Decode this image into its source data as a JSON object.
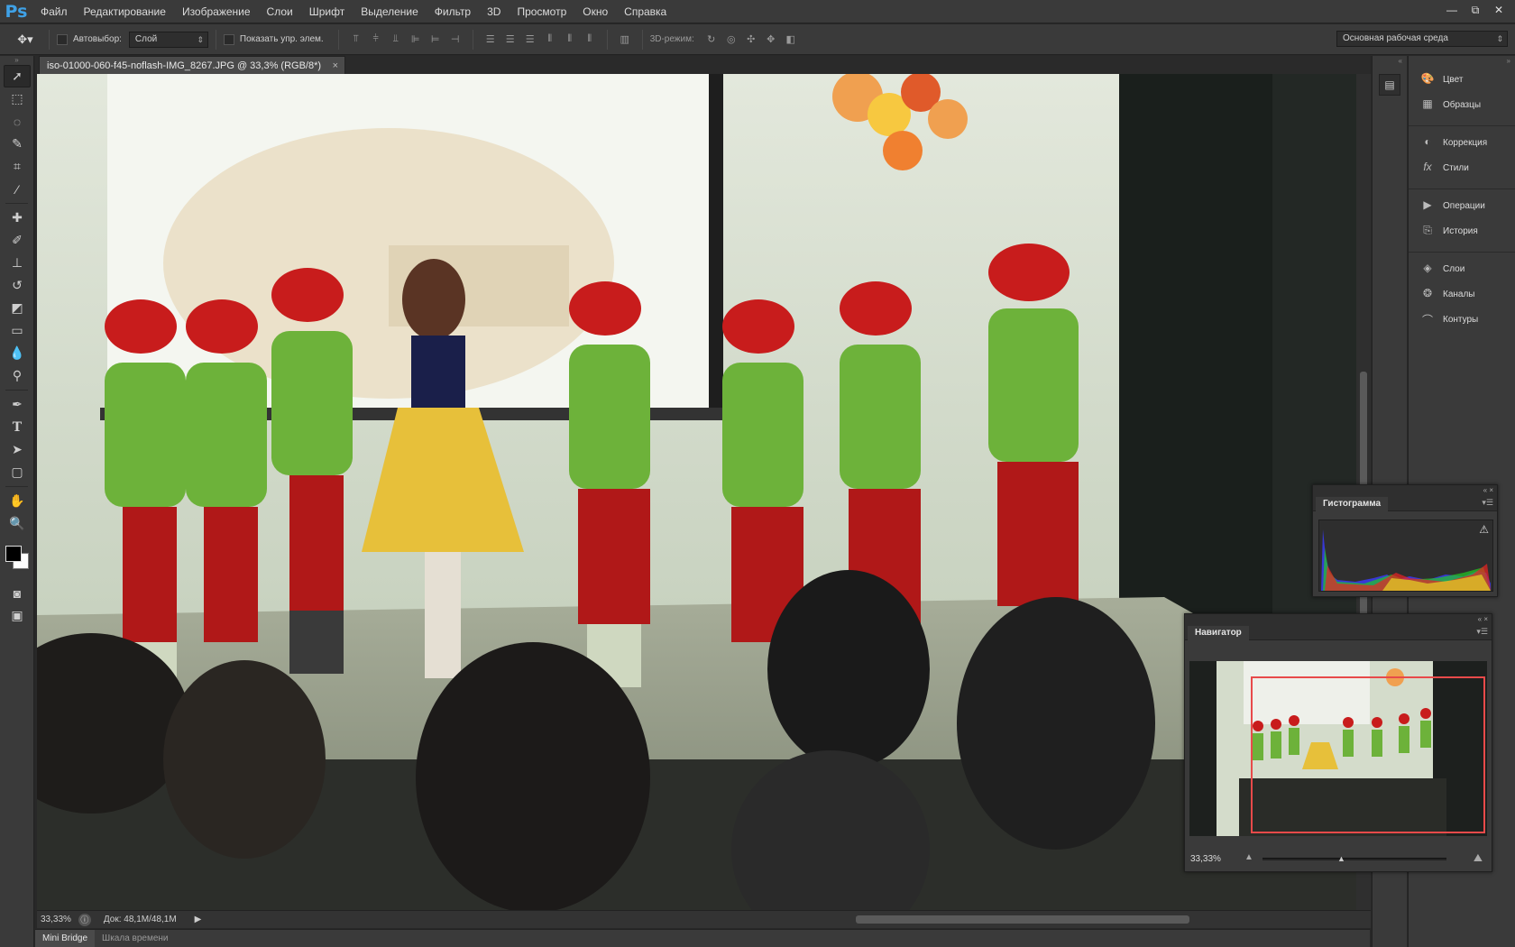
{
  "app": {
    "logo": "Ps"
  },
  "menu": [
    "Файл",
    "Редактирование",
    "Изображение",
    "Слои",
    "Шрифт",
    "Выделение",
    "Фильтр",
    "3D",
    "Просмотр",
    "Окно",
    "Справка"
  ],
  "window_controls": {
    "minimize": "—",
    "restore": "⧉",
    "close": "✕"
  },
  "options": {
    "autoselect_label": "Автовыбор:",
    "autoselect_value": "Слой",
    "show_controls_label": "Показать упр. элем.",
    "mode_3d_label": "3D-режим:",
    "workspace_value": "Основная рабочая среда"
  },
  "document": {
    "tab_title": "iso-01000-060-f45-noflash-IMG_8267.JPG @ 33,3% (RGB/8*)",
    "zoom": "33,33%",
    "doc_size": "Док: 48,1M/48,1M"
  },
  "bottom_tabs": [
    "Mini Bridge",
    "Шкала времени"
  ],
  "dock": {
    "groups": [
      [
        {
          "label": "Цвет",
          "icon": "palette-icon"
        },
        {
          "label": "Образцы",
          "icon": "swatches-icon"
        }
      ],
      [
        {
          "label": "Коррекция",
          "icon": "adjustments-icon"
        },
        {
          "label": "Стили",
          "icon": "styles-icon"
        }
      ],
      [
        {
          "label": "Операции",
          "icon": "play-icon"
        },
        {
          "label": "История",
          "icon": "history-icon"
        }
      ],
      [
        {
          "label": "Слои",
          "icon": "layers-icon"
        },
        {
          "label": "Каналы",
          "icon": "channels-icon"
        },
        {
          "label": "Контуры",
          "icon": "paths-icon"
        }
      ]
    ]
  },
  "histogram": {
    "title": "Гистограмма"
  },
  "navigator": {
    "title": "Навигатор",
    "zoom": "33,33%"
  },
  "tools": [
    "move-tool",
    "marquee-tool",
    "lasso-tool",
    "quick-select-tool",
    "crop-tool",
    "eyedropper-tool",
    "healing-tool",
    "brush-tool",
    "stamp-tool",
    "history-brush-tool",
    "eraser-tool",
    "gradient-tool",
    "blur-tool",
    "dodge-tool",
    "pen-tool",
    "type-tool",
    "path-select-tool",
    "shape-tool",
    "hand-tool",
    "zoom-tool"
  ]
}
